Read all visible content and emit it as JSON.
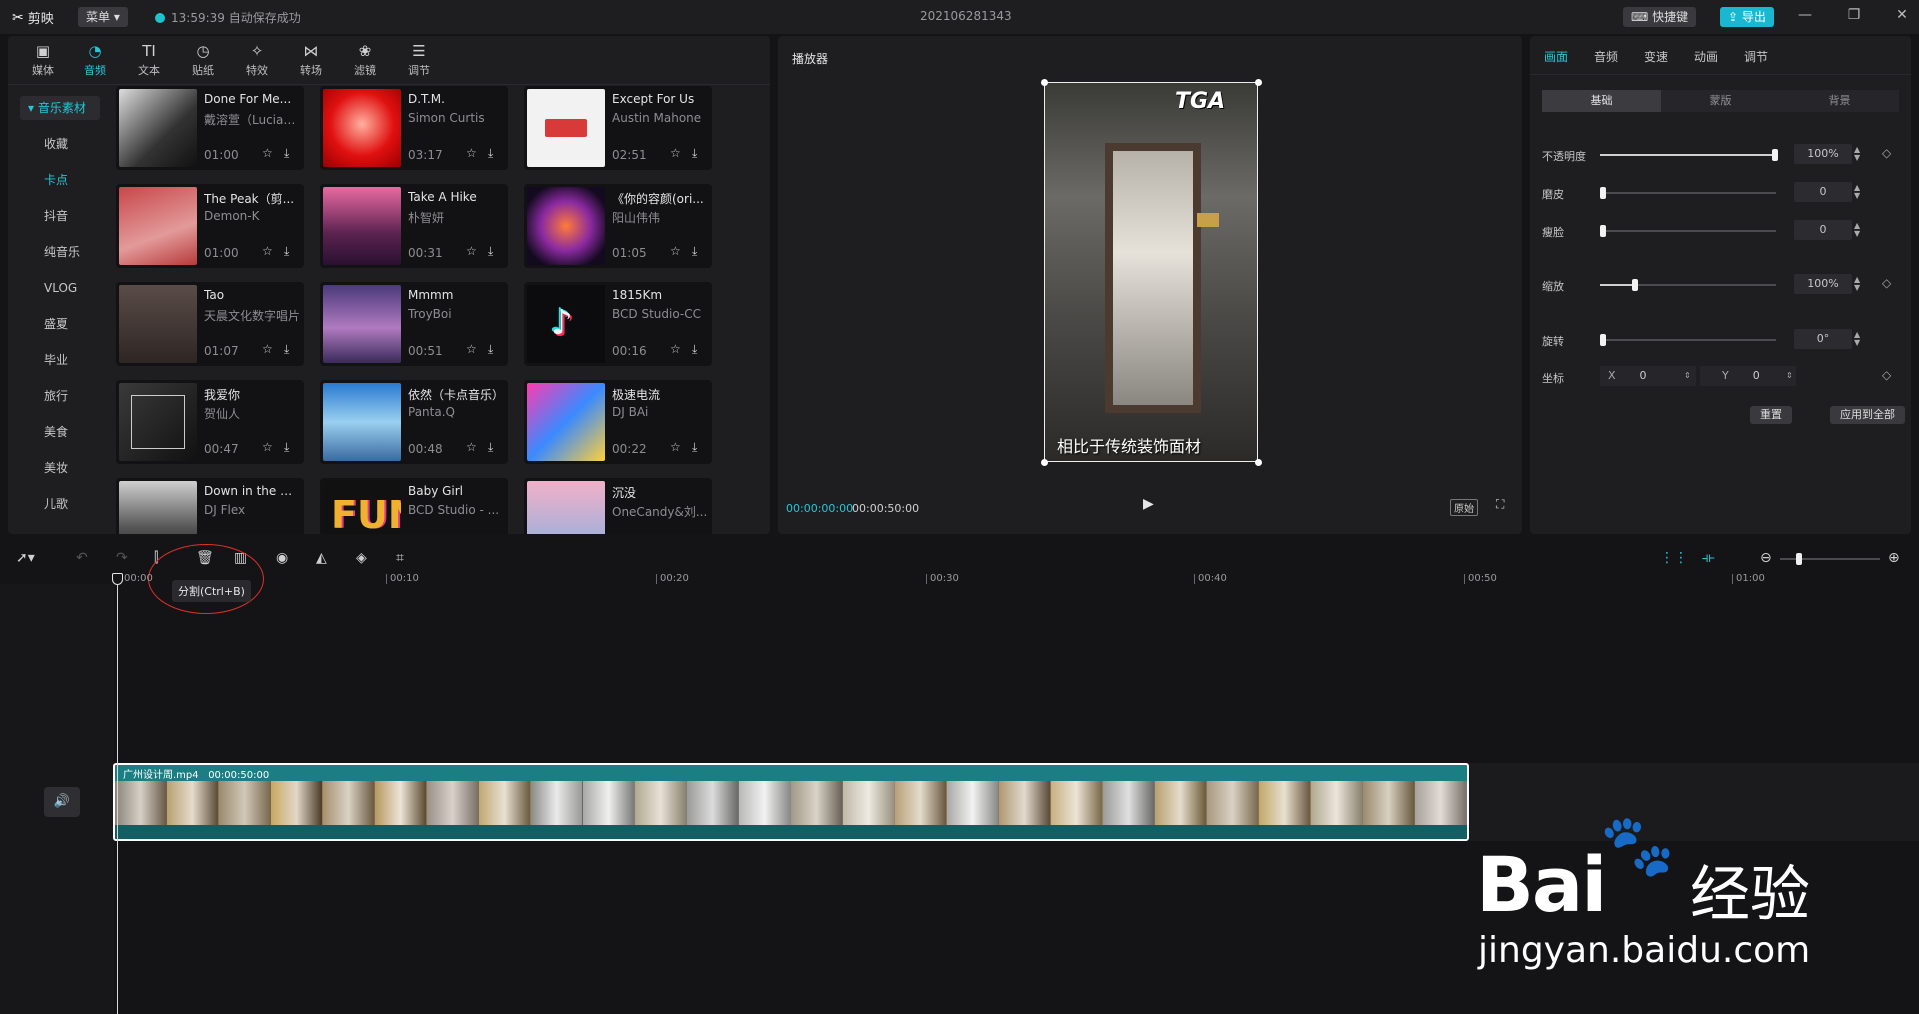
{
  "titlebar": {
    "app_name": "剪映",
    "menu_label": "菜单",
    "save_status": "13:59:39 自动保存成功",
    "doc_title": "202106281343",
    "shortcut_label": "快捷键",
    "export_label": "导出"
  },
  "media": {
    "tabs": [
      {
        "label": "媒体",
        "icon": "media-icon"
      },
      {
        "label": "音频",
        "icon": "audio-icon"
      },
      {
        "label": "文本",
        "icon": "text-icon"
      },
      {
        "label": "贴纸",
        "icon": "sticker-icon"
      },
      {
        "label": "特效",
        "icon": "effects-icon"
      },
      {
        "label": "转场",
        "icon": "transition-icon"
      },
      {
        "label": "滤镜",
        "icon": "filter-icon"
      },
      {
        "label": "调节",
        "icon": "adjust-icon"
      }
    ],
    "categories": [
      "音乐素材",
      "收藏",
      "卡点",
      "抖音",
      "纯音乐",
      "VLOG",
      "盛夏",
      "毕业",
      "旅行",
      "美食",
      "美妆",
      "儿歌"
    ],
    "cards": [
      {
        "title": "Done For Me...",
        "artist": "戴溶萱（Lucian...",
        "duration": "01:00"
      },
      {
        "title": "D.T.M.",
        "artist": "Simon Curtis",
        "duration": "03:17"
      },
      {
        "title": "Except For Us",
        "artist": "Austin Mahone",
        "duration": "02:51"
      },
      {
        "title": "The Peak（剪...",
        "artist": "Demon-K",
        "duration": "01:00"
      },
      {
        "title": "Take A Hike",
        "artist": "朴智妍",
        "duration": "00:31"
      },
      {
        "title": "《你的容颜(ori...",
        "artist": "阳山伟伟",
        "duration": "01:05"
      },
      {
        "title": "Tao",
        "artist": "天晨文化数字唱片",
        "duration": "01:07"
      },
      {
        "title": "Mmmm",
        "artist": "TroyBoi",
        "duration": "00:51"
      },
      {
        "title": "1815Km",
        "artist": "BCD Studio-CC",
        "duration": "00:16"
      },
      {
        "title": "我爱你",
        "artist": "贺仙人",
        "duration": "00:47"
      },
      {
        "title": "依然（卡点音乐）",
        "artist": "Panta.Q",
        "duration": "00:48"
      },
      {
        "title": "极速电流",
        "artist": "DJ BAi",
        "duration": "00:22"
      },
      {
        "title": "Down in the D...",
        "artist": "DJ Flex",
        "duration": ""
      },
      {
        "title": "Baby Girl",
        "artist": "BCD Studio - ...",
        "duration": ""
      },
      {
        "title": "沉没",
        "artist": "OneCandy&刘...",
        "duration": ""
      }
    ]
  },
  "player": {
    "title": "播放器",
    "current_time": "00:00:00:00",
    "total_time": "00:00:50:00",
    "original_label": "原始",
    "preview_logo": "TGA",
    "preview_subtitle": "相比于传统装饰面材"
  },
  "props": {
    "tabs": [
      "画面",
      "音频",
      "变速",
      "动画",
      "调节"
    ],
    "segments": [
      "基础",
      "蒙版",
      "背景"
    ],
    "rows": [
      {
        "label": "不透明度",
        "value": "100%",
        "fill": 1.0
      },
      {
        "label": "磨皮",
        "value": "0",
        "fill": 0.0
      },
      {
        "label": "瘦脸",
        "value": "0",
        "fill": 0.0
      },
      {
        "label": "缩放",
        "value": "100%",
        "fill": 0.2
      },
      {
        "label": "旋转",
        "value": "0°",
        "fill": 0.0
      }
    ],
    "coord_label": "坐标",
    "x_label": "X",
    "x_value": "0",
    "y_label": "Y",
    "y_value": "0",
    "reset_label": "重置",
    "apply_all_label": "应用到全部"
  },
  "timeline": {
    "tooltip": "分割(Ctrl+B)",
    "ruler": [
      "00:00",
      "00:10",
      "00:20",
      "00:30",
      "00:40",
      "00:50",
      "01:00"
    ],
    "clip_name": "广州设计周.mp4",
    "clip_duration": "00:00:50:00"
  },
  "watermark": {
    "brand": "Bai",
    "brand_cn": "经验",
    "url": "jingyan.baidu.com"
  }
}
